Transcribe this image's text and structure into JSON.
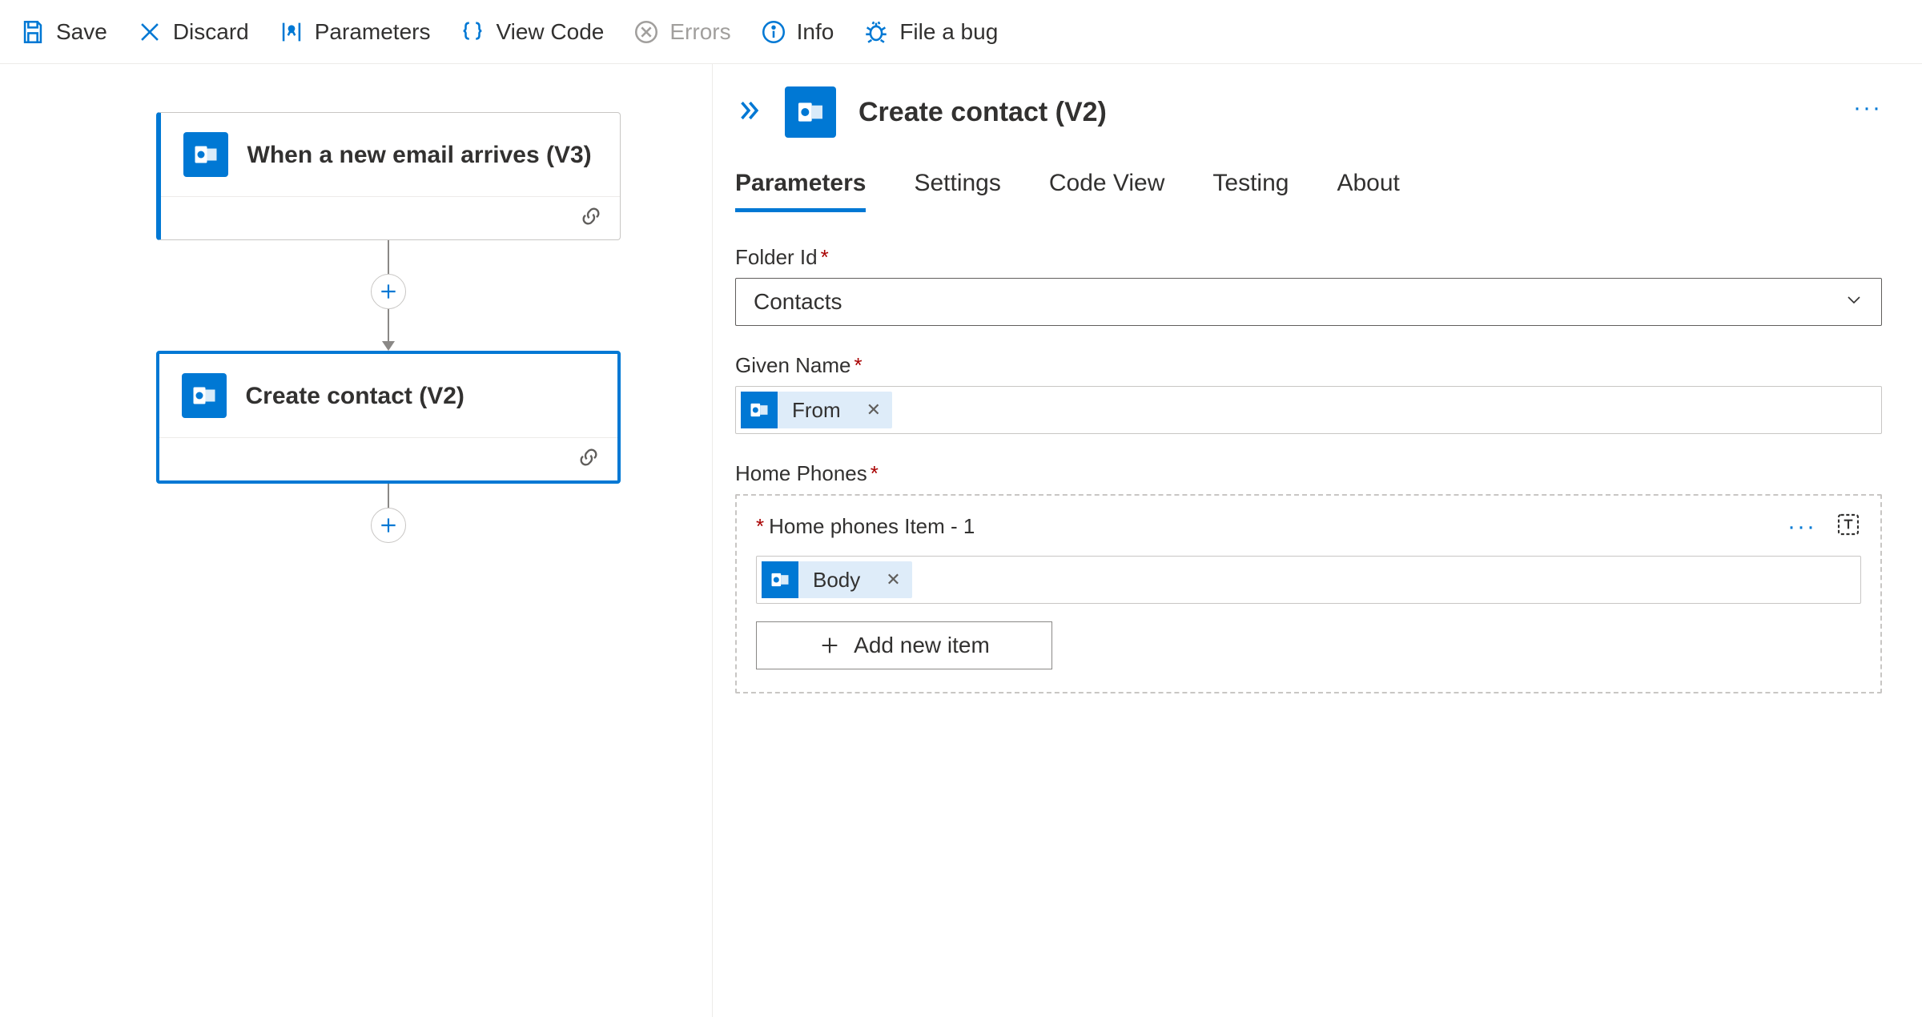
{
  "toolbar": {
    "save": "Save",
    "discard": "Discard",
    "parameters": "Parameters",
    "view_code": "View Code",
    "errors": "Errors",
    "info": "Info",
    "file_bug": "File a bug"
  },
  "flow": {
    "trigger_title": "When a new email arrives (V3)",
    "action_title": "Create contact (V2)"
  },
  "panel": {
    "title": "Create contact (V2)",
    "tabs": {
      "parameters": "Parameters",
      "settings": "Settings",
      "code_view": "Code View",
      "testing": "Testing",
      "about": "About"
    },
    "fields": {
      "folder_id": {
        "label": "Folder Id",
        "value": "Contacts"
      },
      "given_name": {
        "label": "Given Name",
        "token": "From"
      },
      "home_phones": {
        "label": "Home Phones",
        "item_label": "Home phones Item - 1",
        "token": "Body",
        "add_new": "Add new item"
      }
    }
  }
}
